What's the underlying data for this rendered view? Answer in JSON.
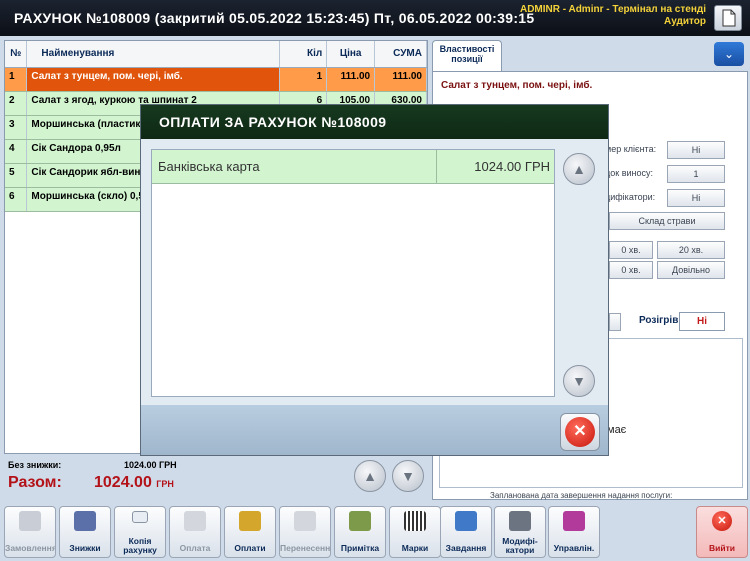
{
  "header": {
    "title": "РАХУНОК  №108009   (закритий 05.05.2022 15:23:45)   Пт, 06.05.2022  00:39:15",
    "user_line1": "ADMINR - Adminr - Термінал на стенді",
    "user_line2": "Аудитор"
  },
  "orders": {
    "columns": [
      "№",
      "Найменування",
      "Кіл",
      "Ціна",
      "СУМА"
    ],
    "rows": [
      {
        "n": "1",
        "name": "Салат з тунцем, пом. чері, імб.",
        "qty": "1",
        "price": "111.00",
        "sum": "111.00"
      },
      {
        "n": "2",
        "name": "Салат з ягод, куркою та шпинат 2",
        "qty": "6",
        "price": "105.00",
        "sum": "630.00"
      },
      {
        "n": "3",
        "name": "Моршинська (пластик) 0,5",
        "qty": "",
        "price": "",
        "sum": ""
      },
      {
        "n": "4",
        "name": "Сік Сандора 0,95л",
        "qty": "",
        "price": "",
        "sum": ""
      },
      {
        "n": "5",
        "name": "Сік Сандорик ябл-вин 0,2",
        "qty": "",
        "price": "",
        "sum": ""
      },
      {
        "n": "6",
        "name": "Моршинська (скло) 0,5л",
        "qty": "",
        "price": "",
        "sum": ""
      }
    ]
  },
  "totals": {
    "no_discount_label": "Без знижки:",
    "no_discount_value": "1024.00 ГРН",
    "total_label": "Разом:",
    "total_value": "1024.00",
    "total_currency": "ГРН"
  },
  "right": {
    "tab_label_1": "Властивості",
    "tab_label_2": "позиції",
    "item_title": "Салат з тунцем, пом. чері, імб.",
    "props": [
      {
        "label": "мер клієнта:",
        "value": "Ні"
      },
      {
        "label": "док виносу:",
        "value": "1"
      },
      {
        "label": "дифікатори:",
        "value": "Ні"
      }
    ],
    "dish_warehouse": "Склад страви",
    "time_buttons": [
      "0 хв.",
      "20 хв.",
      "0 хв.",
      "Довільно"
    ],
    "rozigriv_label": "Розігрів:",
    "rozigriv_value": "Ні",
    "mae_text": "має",
    "planned_text": "Запланована дата завершення надання послуги:"
  },
  "modal": {
    "title": "ОПЛАТИ  ЗА  РАХУНОК  №108009",
    "payments": [
      {
        "name": "Банківська карта",
        "amount": "1024.00 ГРН"
      }
    ]
  },
  "toolbar": {
    "buttons": [
      {
        "label": "Замовлення",
        "state": "disabled"
      },
      {
        "label": "Знижки",
        "state": "enabled"
      },
      {
        "label": "Копія рахунку",
        "state": "enabled"
      },
      {
        "label": "Оплата",
        "state": "disabled"
      },
      {
        "label": "Оплати",
        "state": "enabled"
      },
      {
        "label": "Перенесення",
        "state": "disabled"
      },
      {
        "label": "Примітка",
        "state": "enabled"
      },
      {
        "label": "Марки",
        "state": "enabled"
      },
      {
        "label": "Завдання",
        "state": "enabled"
      },
      {
        "label": "Модифі-катори",
        "state": "enabled"
      },
      {
        "label": "Управлін.",
        "state": "enabled"
      }
    ],
    "exit_label": "Вийти"
  },
  "colors": {
    "selected_row": "#e0540c",
    "row_green": "#d2f5d0",
    "header_bg": "#0b0f16",
    "total_red": "#b41219"
  }
}
